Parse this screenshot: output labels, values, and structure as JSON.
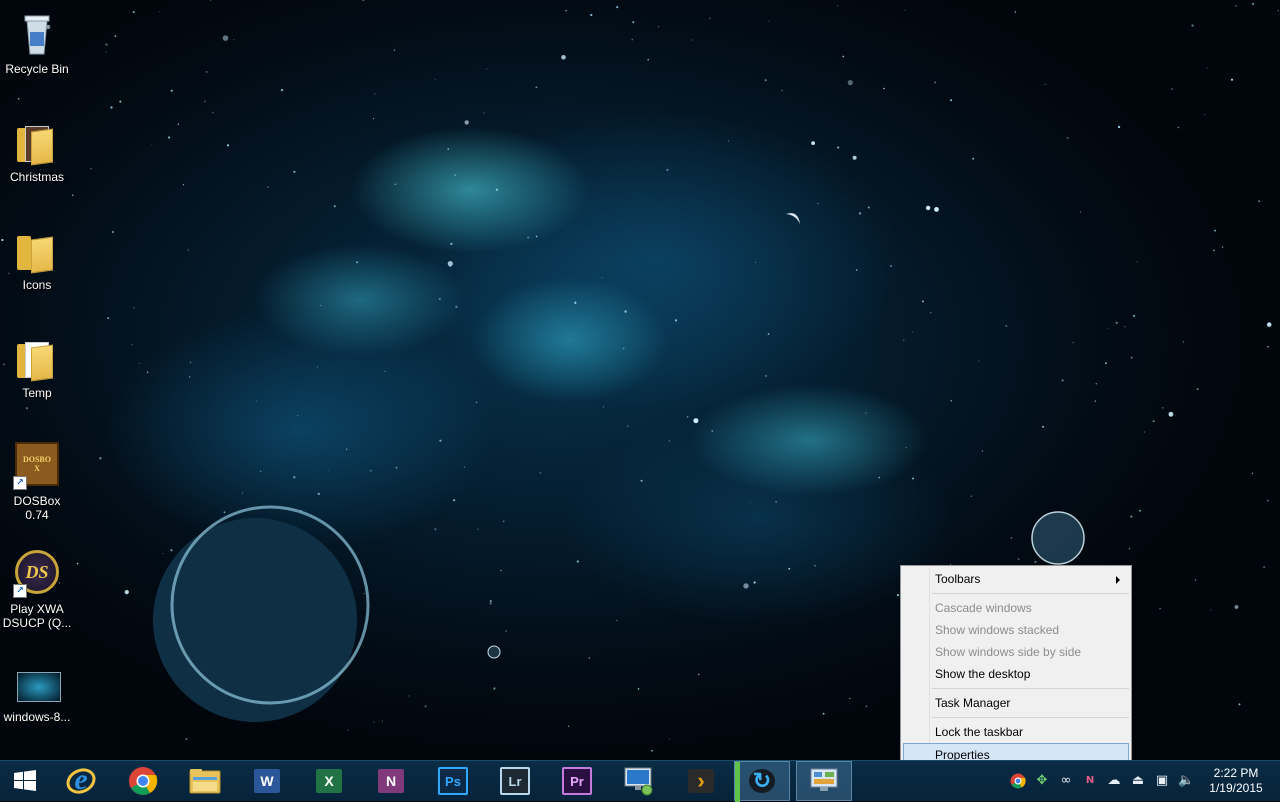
{
  "desktop": {
    "icons": [
      {
        "label": "Recycle Bin"
      },
      {
        "label": "Christmas"
      },
      {
        "label": "Icons"
      },
      {
        "label": "Temp"
      },
      {
        "label": "DOSBox 0.74",
        "glyph": "DOSBOX"
      },
      {
        "label": "Play XWA DSUCP (Q...",
        "glyph": "DS"
      },
      {
        "label": "windows-8..."
      }
    ]
  },
  "context_menu": {
    "items": [
      {
        "label": "Toolbars",
        "has_submenu": true,
        "enabled": true
      },
      {
        "label": "Cascade windows",
        "enabled": false
      },
      {
        "label": "Show windows stacked",
        "enabled": false
      },
      {
        "label": "Show windows side by side",
        "enabled": false
      },
      {
        "label": "Show the desktop",
        "enabled": true
      },
      {
        "label": "Task Manager",
        "enabled": true
      },
      {
        "label": "Lock the taskbar",
        "enabled": true
      },
      {
        "label": "Properties",
        "enabled": true,
        "highlighted": true
      }
    ]
  },
  "taskbar": {
    "apps": [
      {
        "name": "start-button",
        "glyph": ""
      },
      {
        "name": "internet-explorer",
        "glyph": "e"
      },
      {
        "name": "chrome",
        "glyph": ""
      },
      {
        "name": "file-explorer",
        "glyph": ""
      },
      {
        "name": "word",
        "glyph": "W"
      },
      {
        "name": "excel",
        "glyph": "X"
      },
      {
        "name": "onenote",
        "glyph": "N"
      },
      {
        "name": "photoshop",
        "glyph": "Ps"
      },
      {
        "name": "lightroom",
        "glyph": "Lr"
      },
      {
        "name": "premiere",
        "glyph": "Pr"
      },
      {
        "name": "remote-desktop",
        "glyph": ""
      },
      {
        "name": "plex",
        "glyph": "›"
      },
      {
        "name": "sync-app",
        "glyph": "↻"
      },
      {
        "name": "control-panel",
        "glyph": ""
      }
    ],
    "clock": {
      "time": "2:22 PM",
      "date": "1/19/2015"
    },
    "colors": {
      "word": "#2b579a",
      "excel": "#217346",
      "onenote": "#80397b",
      "photoshop": "#0c2a45",
      "lightroom": "#1e2a33",
      "premiere": "#2a1040",
      "menu_highlight": "#d5e6f8"
    }
  }
}
